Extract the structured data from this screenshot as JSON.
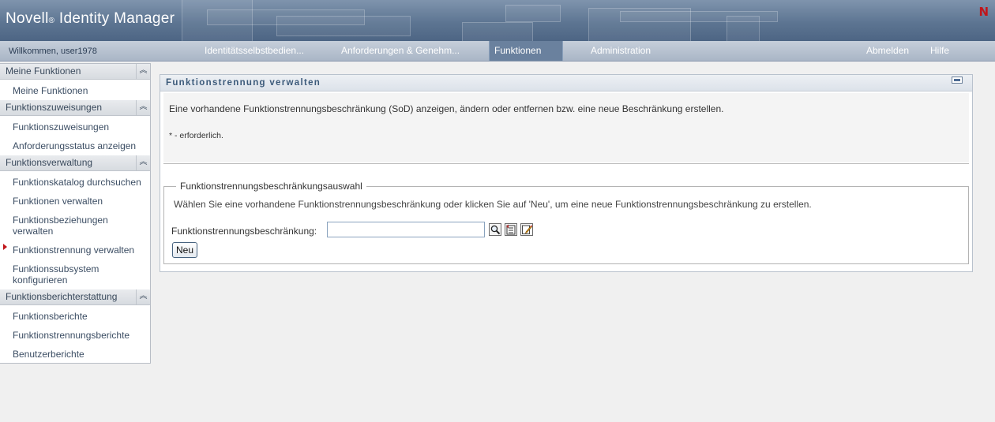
{
  "header": {
    "brand": "Novell",
    "brand_reg": "®",
    "product": "Identity Manager",
    "logo_letter": "N"
  },
  "nav": {
    "welcome": "Willkommen, user1978",
    "tabs": [
      {
        "label": "Identitätsselbstbedien..."
      },
      {
        "label": "Anforderungen & Genehm..."
      },
      {
        "label": "Funktionen",
        "active": true
      },
      {
        "label": "Administration"
      }
    ],
    "logout": "Abmelden",
    "help": "Hilfe"
  },
  "sidebar": {
    "sections": [
      {
        "title": "Meine Funktionen",
        "items": [
          "Meine Funktionen"
        ]
      },
      {
        "title": "Funktionszuweisungen",
        "items": [
          "Funktionszuweisungen",
          "Anforderungsstatus anzeigen"
        ]
      },
      {
        "title": "Funktionsverwaltung",
        "items": [
          "Funktionskatalog durchsuchen",
          "Funktionen verwalten",
          "Funktionsbeziehungen verwalten",
          "Funktionstrennung verwalten",
          "Funktionssubsystem konfigurieren"
        ]
      },
      {
        "title": "Funktionsberichterstattung",
        "items": [
          "Funktionsberichte",
          "Funktionstrennungsberichte",
          "Benutzerberichte"
        ]
      }
    ],
    "active_item": "Funktionstrennung verwalten"
  },
  "panel": {
    "title": "Funktionstrennung verwalten",
    "description": "Eine vorhandene Funktionstrennungsbeschränkung (SoD) anzeigen, ändern oder entfernen bzw. eine neue Beschränkung erstellen.",
    "required_note": "* - erforderlich.",
    "fieldset": {
      "legend": "Funktionstrennungsbeschränkungsauswahl",
      "instruction": "Wählen Sie eine vorhandene Funktionstrennungsbeschränkung oder klicken Sie auf 'Neu', um eine neue Funktionstrennungsbeschränkung zu erstellen.",
      "field_label": "Funktionstrennungsbeschränkung:",
      "field_value": "",
      "new_button": "Neu"
    }
  },
  "colors": {
    "banner": "#5d7592",
    "active_tab": "#6a819e",
    "marker": "#c0161b"
  }
}
